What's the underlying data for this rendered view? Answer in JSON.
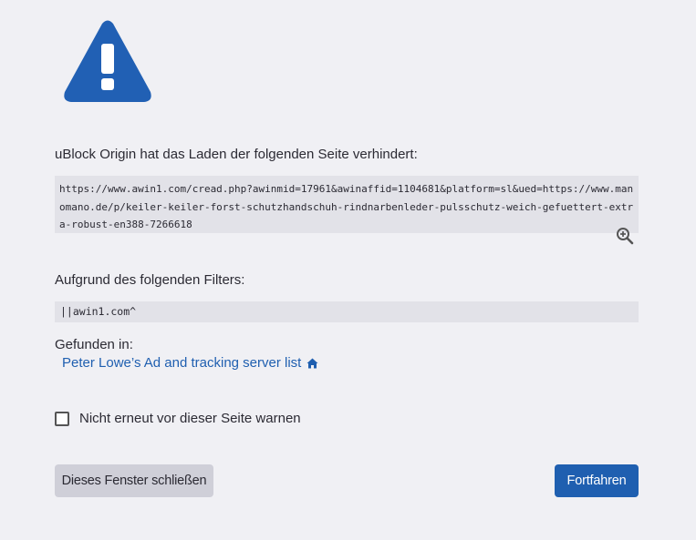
{
  "icon": {
    "name": "warning-triangle-icon",
    "color": "#2160b4"
  },
  "blocked_message": "uBlock Origin hat das Laden der folgenden Seite verhindert:",
  "blocked_url": "https://www.awin1.com/cread.php?awinmid=17961&awinaffid=1104681&platform=sl&ued=https://www.manomano.de/p/keiler-keiler-forst-schutzhandschuh-rindnarbenleder-pulsschutz-weich-gefuettert-extra-robust-en388-7266618",
  "zoom_icon": "zoom-in-icon",
  "filter_label": "Aufgrund des folgenden Filters:",
  "filter_value": "||awin1.com^",
  "found_in_label": "Gefunden in:",
  "filter_list": {
    "label": "Peter Lowe’s Ad and tracking server list",
    "icon": "home-icon",
    "color": "#1f5fb0"
  },
  "dont_warn": {
    "label": "Nicht erneut vor dieser Seite warnen",
    "checked": false
  },
  "buttons": {
    "close_label": "Dieses Fenster schließen",
    "continue_label": "Fortfahren",
    "continue_color": "#1f5fb0"
  }
}
